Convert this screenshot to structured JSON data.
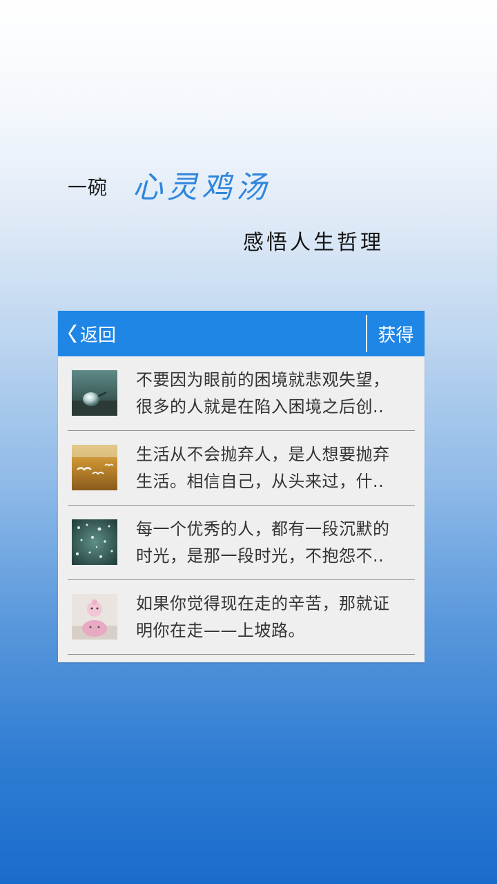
{
  "hero": {
    "prefix": "一碗",
    "title": "心灵鸡汤",
    "subtitle": "感悟人生哲理"
  },
  "header": {
    "back_label": "返回",
    "back_icon": "chevron-left-icon",
    "action_label": "获得"
  },
  "items": [
    {
      "line1": "不要因为眼前的困境就悲观失望，",
      "line2": "很多的人就是在陷入困境之后创..",
      "thumb": "water-drop-photo"
    },
    {
      "line1": "生活从不会抛弃人，是人想要抛弃",
      "line2": "生活。相信自己，从头来过，什..",
      "thumb": "seagulls-photo"
    },
    {
      "line1": "每一个优秀的人，都有一段沉默的",
      "line2": "时光，是那一段时光，不抱怨不..",
      "thumb": "rain-glass-photo"
    },
    {
      "line1": "如果你觉得现在走的辛苦，那就证",
      "line2": "明你在走——上坡路。",
      "thumb": "toy-doll-photo"
    }
  ],
  "colors": {
    "header_bg": "#1f86e5",
    "title_blue": "#2f86dc",
    "list_bg": "#efefef"
  }
}
